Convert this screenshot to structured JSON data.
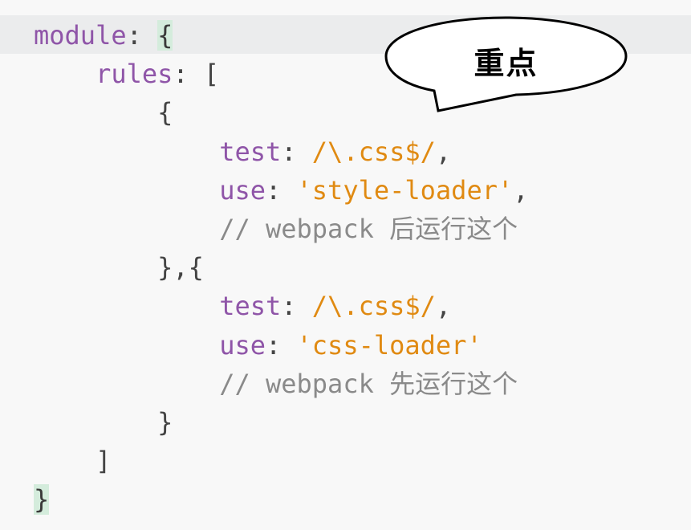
{
  "editor": {
    "lines": [
      {
        "indent": "",
        "tokens": [
          {
            "cls": "kw",
            "text": "module"
          },
          {
            "cls": "punct",
            "text": ": "
          },
          {
            "cls": "bracket-hl",
            "text": "{"
          }
        ]
      },
      {
        "indent": "    ",
        "tokens": [
          {
            "cls": "kw",
            "text": "rules"
          },
          {
            "cls": "punct",
            "text": ": ["
          }
        ]
      },
      {
        "indent": "        ",
        "tokens": [
          {
            "cls": "punct",
            "text": "{"
          }
        ]
      },
      {
        "indent": "            ",
        "tokens": [
          {
            "cls": "kw",
            "text": "test"
          },
          {
            "cls": "punct",
            "text": ": "
          },
          {
            "cls": "str",
            "text": "/\\.css$/"
          },
          {
            "cls": "punct",
            "text": ","
          }
        ]
      },
      {
        "indent": "            ",
        "tokens": [
          {
            "cls": "kw",
            "text": "use"
          },
          {
            "cls": "punct",
            "text": ": "
          },
          {
            "cls": "str",
            "text": "'style-loader'"
          },
          {
            "cls": "punct",
            "text": ","
          }
        ]
      },
      {
        "indent": "            ",
        "tokens": [
          {
            "cls": "cmt",
            "text": "// webpack 后运行这个"
          }
        ]
      },
      {
        "indent": "        ",
        "tokens": [
          {
            "cls": "punct",
            "text": "},{"
          }
        ]
      },
      {
        "indent": "            ",
        "tokens": [
          {
            "cls": "kw",
            "text": "test"
          },
          {
            "cls": "punct",
            "text": ": "
          },
          {
            "cls": "str",
            "text": "/\\.css$/"
          },
          {
            "cls": "punct",
            "text": ","
          }
        ]
      },
      {
        "indent": "            ",
        "tokens": [
          {
            "cls": "kw",
            "text": "use"
          },
          {
            "cls": "punct",
            "text": ": "
          },
          {
            "cls": "str",
            "text": "'css-loader'"
          }
        ]
      },
      {
        "indent": "            ",
        "tokens": [
          {
            "cls": "cmt",
            "text": "// webpack 先运行这个"
          }
        ]
      },
      {
        "indent": "        ",
        "tokens": [
          {
            "cls": "punct",
            "text": "}"
          }
        ]
      },
      {
        "indent": "    ",
        "tokens": [
          {
            "cls": "punct",
            "text": "]"
          }
        ]
      },
      {
        "indent": "",
        "tokens": [
          {
            "cls": "bracket-hl",
            "text": "}"
          }
        ]
      }
    ]
  },
  "callout": {
    "text": "重点"
  },
  "colors": {
    "background": "#f8f8f8",
    "active_line": "#ebeced",
    "keyword": "#8f55a8",
    "string": "#e08a12",
    "comment": "#8a8a8a",
    "bracket_match": "#d4ecdc"
  }
}
